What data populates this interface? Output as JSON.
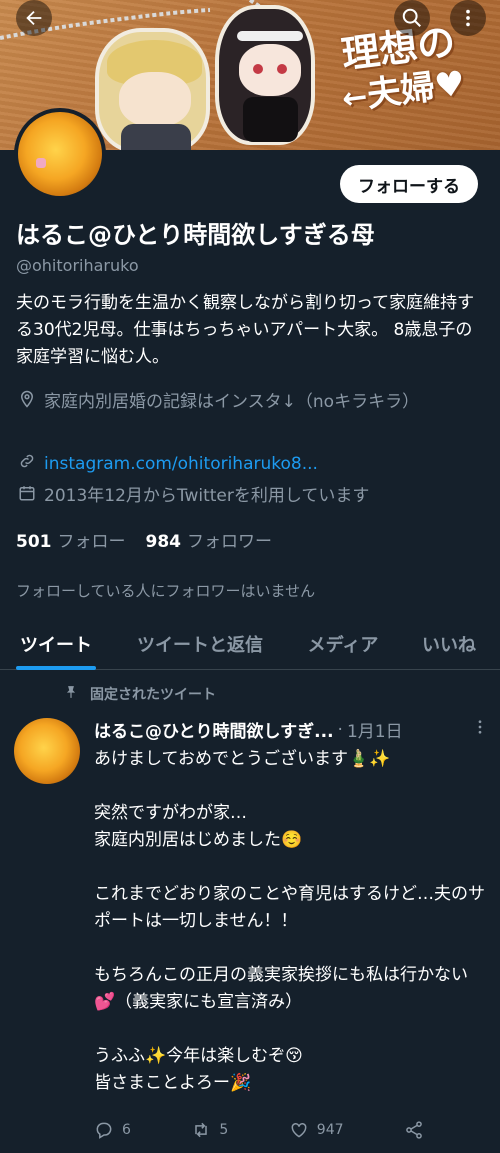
{
  "header": {
    "back_icon": "arrow-left-icon",
    "search_icon": "search-icon",
    "more_icon": "more-vertical-icon",
    "banner_text_line1": "理想の",
    "banner_text_line2": "夫婦♥",
    "banner_arrow": "←"
  },
  "profile": {
    "follow_button": "フォローする",
    "name": "はるこ@ひとり時間欲しすぎる母",
    "handle": "@ohitoriharuko",
    "bio": "夫のモラ行動を生温かく観察しながら割り切って家庭維持する30代2児母。仕事はちっちゃいアパート大家。 8歳息子の家庭学習に悩む人。",
    "location": "家庭内別居婚の記録はインスタ↓（noキラキラ）",
    "link": "instagram.com/ohitoriharuko8...",
    "joined": "2013年12月からTwitterを利用しています",
    "following_count": "501",
    "following_label": "フォロー",
    "followers_count": "984",
    "followers_label": "フォロワー",
    "no_mutual_followers": "フォローしている人にフォロワーはいません"
  },
  "tabs": [
    {
      "label": "ツイート",
      "active": true
    },
    {
      "label": "ツイートと返信",
      "active": false
    },
    {
      "label": "メディア",
      "active": false
    },
    {
      "label": "いいね",
      "active": false
    }
  ],
  "tweet": {
    "pinned_label": "固定されたツイート",
    "author": "はるこ@ひとり時間欲しすぎる母",
    "author_display": "はるこ@ひとり時間欲しすぎ...",
    "date": "1月1日",
    "paragraphs": [
      "あけましておめでとうございます🎍✨",
      "突然ですがわが家…\n家庭内別居はじめました☺️",
      "これまでどおり家のことや育児はするけど…夫のサポートは一切しません！！",
      "もちろんこの正月の義実家挨拶にも私は行かない💕（義実家にも宣言済み）",
      "うふふ✨今年は楽しむぞ😚\n皆さまことよろー🎉"
    ],
    "reply_count": "6",
    "retweet_count": "5",
    "like_count": "947"
  }
}
